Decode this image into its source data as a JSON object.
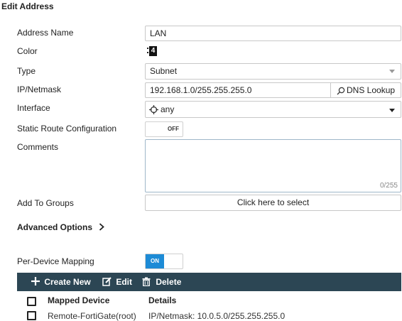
{
  "page": {
    "title": "Edit Address"
  },
  "form": {
    "address_name": {
      "label": "Address Name",
      "value": "LAN"
    },
    "color": {
      "label": "Color",
      "value": "4"
    },
    "type": {
      "label": "Type",
      "value": "Subnet"
    },
    "ip_netmask": {
      "label": "IP/Netmask",
      "value": "192.168.1.0/255.255.255.0",
      "dns_lookup": "DNS Lookup"
    },
    "interface": {
      "label": "Interface",
      "value": "any"
    },
    "static_route": {
      "label": "Static Route Configuration",
      "toggle": "OFF"
    },
    "comments": {
      "label": "Comments",
      "value": "",
      "counter": "0/255"
    },
    "add_to_groups": {
      "label": "Add To Groups",
      "button": "Click here to select"
    }
  },
  "advanced_options": {
    "label": "Advanced Options"
  },
  "per_device_mapping": {
    "label": "Per-Device Mapping",
    "toggle": "ON"
  },
  "toolbar": {
    "create_new": "Create New",
    "edit": "Edit",
    "delete": "Delete"
  },
  "table": {
    "headers": [
      "Mapped Device",
      "Details"
    ],
    "rows": [
      {
        "device": "Remote-FortiGate(root)",
        "details": "IP/Netmask: 10.0.5.0/255.255.255.0"
      }
    ]
  },
  "colors": {
    "toolbar_bg": "#2c4654",
    "toggle_on": "#1d8bd6"
  }
}
